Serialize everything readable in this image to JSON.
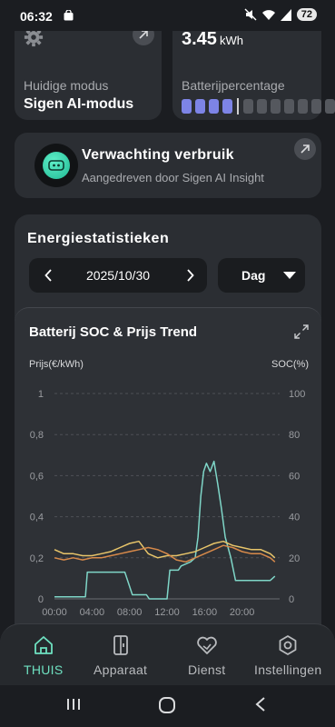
{
  "status_bar": {
    "time": "06:32",
    "battery": "72"
  },
  "mode_card": {
    "label": "Huidige modus",
    "value": "Sigen AI-modus"
  },
  "battery_card": {
    "value": "3.45",
    "unit": "kWh",
    "label": "Batterijpercentage",
    "level_percent": 30,
    "segments_on": 4,
    "segments_total": 12
  },
  "forecast_card": {
    "title": "Verwachting verbruik",
    "subtitle": "Aangedreven door Sigen AI Insight"
  },
  "stats": {
    "title": "Energiestatistieken",
    "date": "2025/10/30",
    "period": "Dag"
  },
  "chart_card": {
    "title": "Batterij SOC & Prijs Trend",
    "left_axis_label": "Prijs(€/kWh)",
    "right_axis_label": "SOC(%)",
    "colors": {
      "soc": "#7fd6c8",
      "price_a": "#e8c56a",
      "price_b": "#d88a4a"
    }
  },
  "chart_data": {
    "type": "line",
    "title": "Batterij SOC & Prijs Trend",
    "xlabel": "",
    "ylabel": "Prijs(€/kWh)",
    "y2label": "SOC(%)",
    "x_ticks": [
      "00:00",
      "04:00",
      "08:00",
      "12:00",
      "16:00",
      "20:00"
    ],
    "y_ticks": [
      "0",
      "0,2",
      "0,4",
      "0,6",
      "0,8",
      "1"
    ],
    "y2_ticks": [
      "0",
      "20",
      "40",
      "60",
      "80",
      "100"
    ],
    "ylim": [
      0,
      1
    ],
    "y2lim": [
      0,
      100
    ],
    "xlim": [
      0,
      24
    ],
    "grid": true,
    "series": [
      {
        "name": "SOC(%)",
        "axis": "right",
        "x": [
          0,
          3.3,
          3.5,
          7.5,
          8.3,
          9.8,
          10.1,
          12.0,
          12.3,
          13.2,
          13.5,
          14.0,
          14.5,
          15.0,
          15.3,
          15.6,
          15.9,
          16.2,
          16.6,
          17.0,
          17.4,
          17.8,
          18.2,
          18.8,
          19.3,
          20.0,
          23.0,
          23.5
        ],
        "values": [
          1,
          1,
          13,
          13,
          2,
          2,
          0,
          0,
          14,
          14,
          16,
          17,
          18,
          20,
          30,
          50,
          62,
          66,
          62,
          67,
          56,
          44,
          30,
          20,
          9,
          9,
          9,
          11
        ]
      },
      {
        "name": "",
        "axis": "left",
        "x": [
          0,
          1,
          2,
          3,
          4,
          5,
          6,
          7,
          8,
          9,
          10,
          11,
          12,
          13,
          14,
          15,
          16,
          17,
          18,
          19,
          20,
          21,
          22,
          23,
          23.5
        ],
        "values": [
          0.24,
          0.22,
          0.22,
          0.21,
          0.21,
          0.22,
          0.23,
          0.25,
          0.27,
          0.28,
          0.22,
          0.2,
          0.21,
          0.21,
          0.22,
          0.23,
          0.25,
          0.27,
          0.28,
          0.26,
          0.25,
          0.24,
          0.24,
          0.22,
          0.2
        ]
      },
      {
        "name": "",
        "axis": "left",
        "x": [
          0,
          1,
          2,
          3,
          4,
          5,
          6,
          7,
          8,
          9,
          10,
          11,
          12,
          13,
          14,
          15,
          16,
          17,
          18,
          19,
          20,
          21,
          22,
          23,
          23.5
        ],
        "values": [
          0.2,
          0.19,
          0.2,
          0.19,
          0.2,
          0.2,
          0.21,
          0.22,
          0.23,
          0.24,
          0.25,
          0.24,
          0.22,
          0.19,
          0.18,
          0.2,
          0.22,
          0.24,
          0.26,
          0.25,
          0.23,
          0.22,
          0.22,
          0.2,
          0.18
        ]
      }
    ]
  },
  "bottom_nav": {
    "items": [
      {
        "label": "THUIS",
        "icon": "home-icon",
        "active": true
      },
      {
        "label": "Apparaat",
        "icon": "device-icon",
        "active": false
      },
      {
        "label": "Dienst",
        "icon": "service-icon",
        "active": false
      },
      {
        "label": "Instellingen",
        "icon": "settings-icon",
        "active": false
      }
    ]
  }
}
